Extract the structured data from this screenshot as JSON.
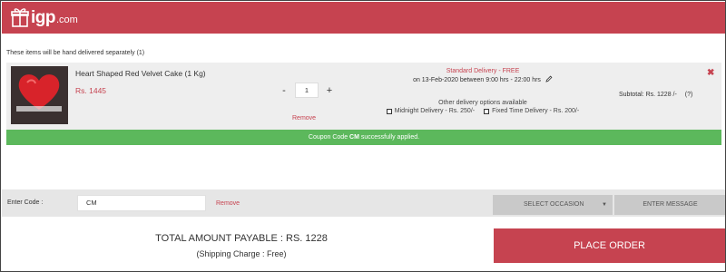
{
  "header": {
    "logo_text": "igp",
    "logo_domain": ".com",
    "brand_color": "#c64350"
  },
  "cart": {
    "separate_delivery_note": "These items will be hand delivered separately (1)",
    "item": {
      "name": "Heart Shaped Red Velvet Cake (1 Kg)",
      "price": "Rs. 1445",
      "qty_minus": "-",
      "quantity": "1",
      "qty_plus": "+",
      "remove_label": "Remove",
      "delivery_type": "Standard Delivery - FREE",
      "delivery_date": "on 13-Feb-2020 between 9:00 hrs - 22:00 hrs",
      "other_options_label": "Other delivery options available",
      "options": [
        "Midnight Delivery - Rs. 250/-",
        "Fixed Time Delivery - Rs. 200/-"
      ],
      "subtotal": "Subtotal: Rs. 1228 /-",
      "help": "(?)",
      "close_glyph": "✖"
    },
    "coupon_message": {
      "prefix": "Coupon Code ",
      "code": "CM",
      "suffix": " successfully applied."
    }
  },
  "code_bar": {
    "label": "Enter Code :",
    "value": "CM",
    "remove_label": "Remove",
    "occasion_label": "SELECT OCCASION",
    "occasion_arrow": "▼",
    "message_label": "ENTER MESSAGE"
  },
  "summary": {
    "total": "TOTAL AMOUNT PAYABLE : RS. 1228",
    "shipping": "(Shipping Charge : Free)",
    "place_order": "PLACE ORDER"
  },
  "colors": {
    "accent": "#c64350",
    "success": "#5cb85c",
    "panel": "#eeeeee",
    "button_grey": "#c9c9c9"
  },
  "icons": {
    "logo": "gift-box-icon",
    "edit": "pencil-icon",
    "close": "close-icon",
    "dropdown": "chevron-down-icon"
  }
}
